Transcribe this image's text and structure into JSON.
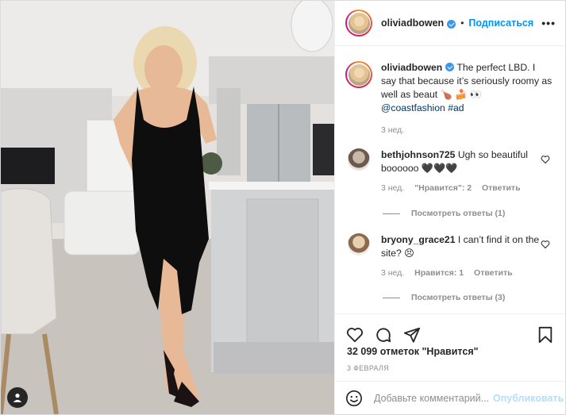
{
  "header": {
    "username": "oliviadbowen",
    "separator": "•",
    "follow_label": "Подписаться",
    "more_label": "•••"
  },
  "caption": {
    "username": "oliviadbowen",
    "text": "The perfect LBD. I say that because it’s seriously roomy as well as beaut 🍗 🍰 👀",
    "mention": "@coastfashion",
    "hashtag": "#ad",
    "time": "3 нед."
  },
  "comments": [
    {
      "username": "bethjohnson725",
      "text": "Ugh so beautiful boooooo 🖤🖤🖤",
      "time": "3 нед.",
      "likes": "\"Нравится\": 2",
      "reply": "Ответить",
      "view_replies": "Посмотреть ответы (1)"
    },
    {
      "username": "bryony_grace21",
      "text": "I can’t find it on the site? 😣",
      "time": "3 нед.",
      "likes": "Нравится: 1",
      "reply": "Ответить",
      "view_replies": "Посмотреть ответы (3)"
    }
  ],
  "actions": {
    "likes": "32 099 отметок \"Нравится\"",
    "date": "3 февраля"
  },
  "add_comment": {
    "placeholder": "Добавьте комментарий...",
    "publish_label": "Опубликовать"
  },
  "colors": {
    "accent": "#0095f6",
    "verified": "#3897f0",
    "muted": "#8e8e8e",
    "publish_disabled": "#b2dffc"
  },
  "icons": [
    "verified-badge-icon",
    "heart-icon",
    "comment-icon",
    "share-icon",
    "bookmark-icon",
    "emoji-icon",
    "user-tag-icon"
  ]
}
